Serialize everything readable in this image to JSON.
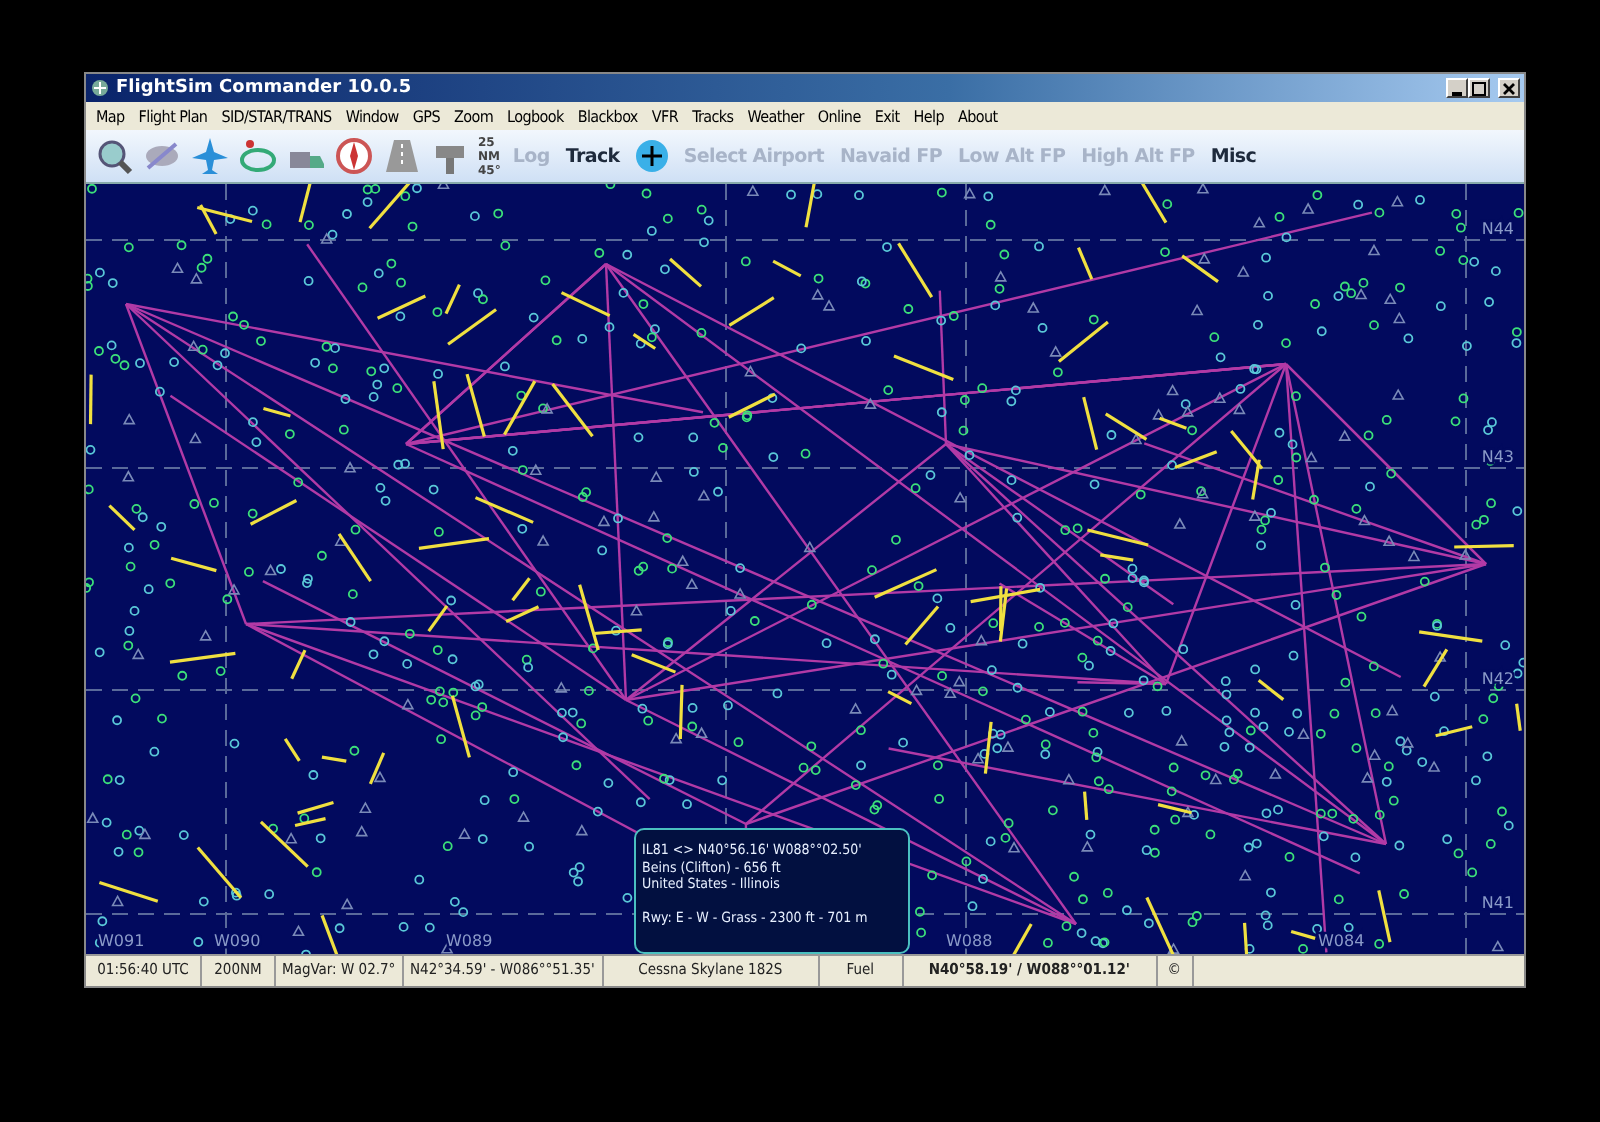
{
  "window": {
    "title": "FlightSim Commander 10.0.5"
  },
  "menu": [
    "Map",
    "Flight Plan",
    "SID/STAR/TRANS",
    "Window",
    "GPS",
    "Zoom",
    "Logbook",
    "Blackbox",
    "VFR",
    "Tracks",
    "Weather",
    "Online",
    "Exit",
    "Help",
    "About"
  ],
  "toolbar": {
    "range_icon": {
      "distance": "25",
      "unit": "NM",
      "angle": "45°"
    },
    "buttons": [
      {
        "label": "Log",
        "disabled": true
      },
      {
        "label": "Track",
        "disabled": false
      },
      {
        "label": "Select Airport",
        "disabled": true
      },
      {
        "label": "Navaid FP",
        "disabled": true
      },
      {
        "label": "Low Alt FP",
        "disabled": true
      },
      {
        "label": "High Alt FP",
        "disabled": true
      },
      {
        "label": "Misc",
        "disabled": false
      }
    ]
  },
  "map": {
    "latitude_labels": [
      "N44",
      "N43",
      "N42",
      "N41"
    ],
    "longitude_labels": [
      "W091",
      "W090",
      "W089",
      "W088",
      "W084"
    ]
  },
  "info_popup": {
    "lines": [
      "IL81  <>  N40°56.16'  W088°°02.50'",
      "Beins (Clifton) - 656 ft",
      "United States - Illinois",
      "Rwy: E  -  W  -  Grass  -  2300 ft  -  701 m"
    ]
  },
  "status_bar": [
    {
      "text": "01:56:40 UTC",
      "bold": false
    },
    {
      "text": "200NM",
      "bold": false
    },
    {
      "text": "MagVar: W 02.7°",
      "bold": false
    },
    {
      "text": "N42°34.59' - W086°°51.35'",
      "bold": false
    },
    {
      "text": "Cessna Skylane 182S",
      "bold": false
    },
    {
      "text": "Fuel",
      "bold": false
    },
    {
      "text": "N40°58.19' / W088°°01.12'",
      "bold": true
    },
    {
      "text": "©",
      "bold": false
    }
  ]
}
